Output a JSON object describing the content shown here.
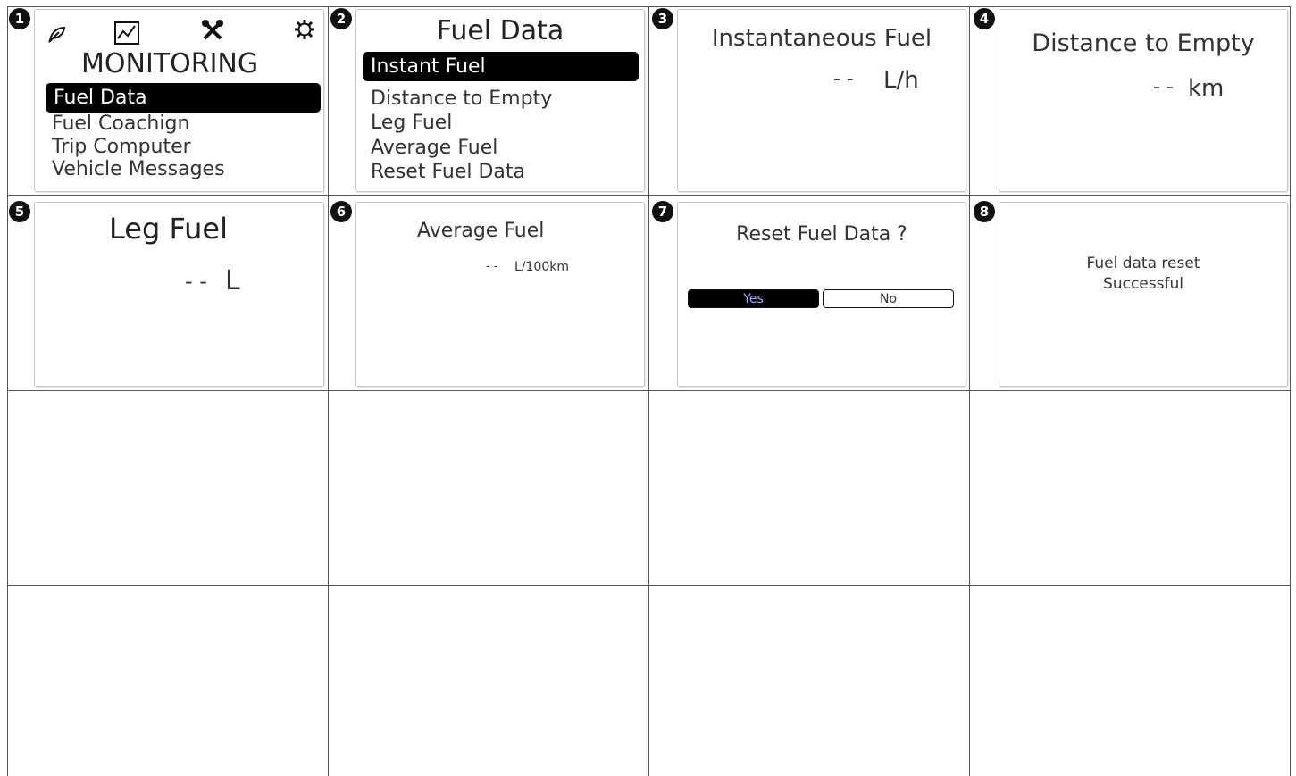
{
  "steps": [
    "1",
    "2",
    "3",
    "4",
    "5",
    "6",
    "7",
    "8"
  ],
  "screen1": {
    "icons": [
      "leaf-icon",
      "chart-icon",
      "wrench-icon",
      "gear-icon"
    ],
    "title": "MONITORING",
    "selected": "Fuel Data",
    "items": [
      "Fuel Coachign",
      "Trip Computer",
      "Vehicle Messages"
    ]
  },
  "screen2": {
    "title": "Fuel Data",
    "selected": "Instant Fuel",
    "items": [
      "Distance to Empty",
      "Leg Fuel",
      "Average Fuel",
      "Reset Fuel Data"
    ]
  },
  "screen3": {
    "title": "Instantaneous Fuel",
    "value": "- -",
    "unit": "L/h"
  },
  "screen4": {
    "title": "Distance to Empty",
    "value": "- -",
    "unit": "km"
  },
  "screen5": {
    "title": "Leg Fuel",
    "value": "- -",
    "unit": "L"
  },
  "screen6": {
    "title": "Average Fuel",
    "value": "- -",
    "unit": "L/100km"
  },
  "screen7": {
    "title": "Reset Fuel Data ?",
    "yes_label": "Yes",
    "no_label": "No"
  },
  "screen8": {
    "line1": "Fuel data reset",
    "line2": "Successful"
  },
  "colors": {
    "selection_bg": "#000000",
    "yes_text": "#a9a9ff",
    "grid": "#555555"
  }
}
